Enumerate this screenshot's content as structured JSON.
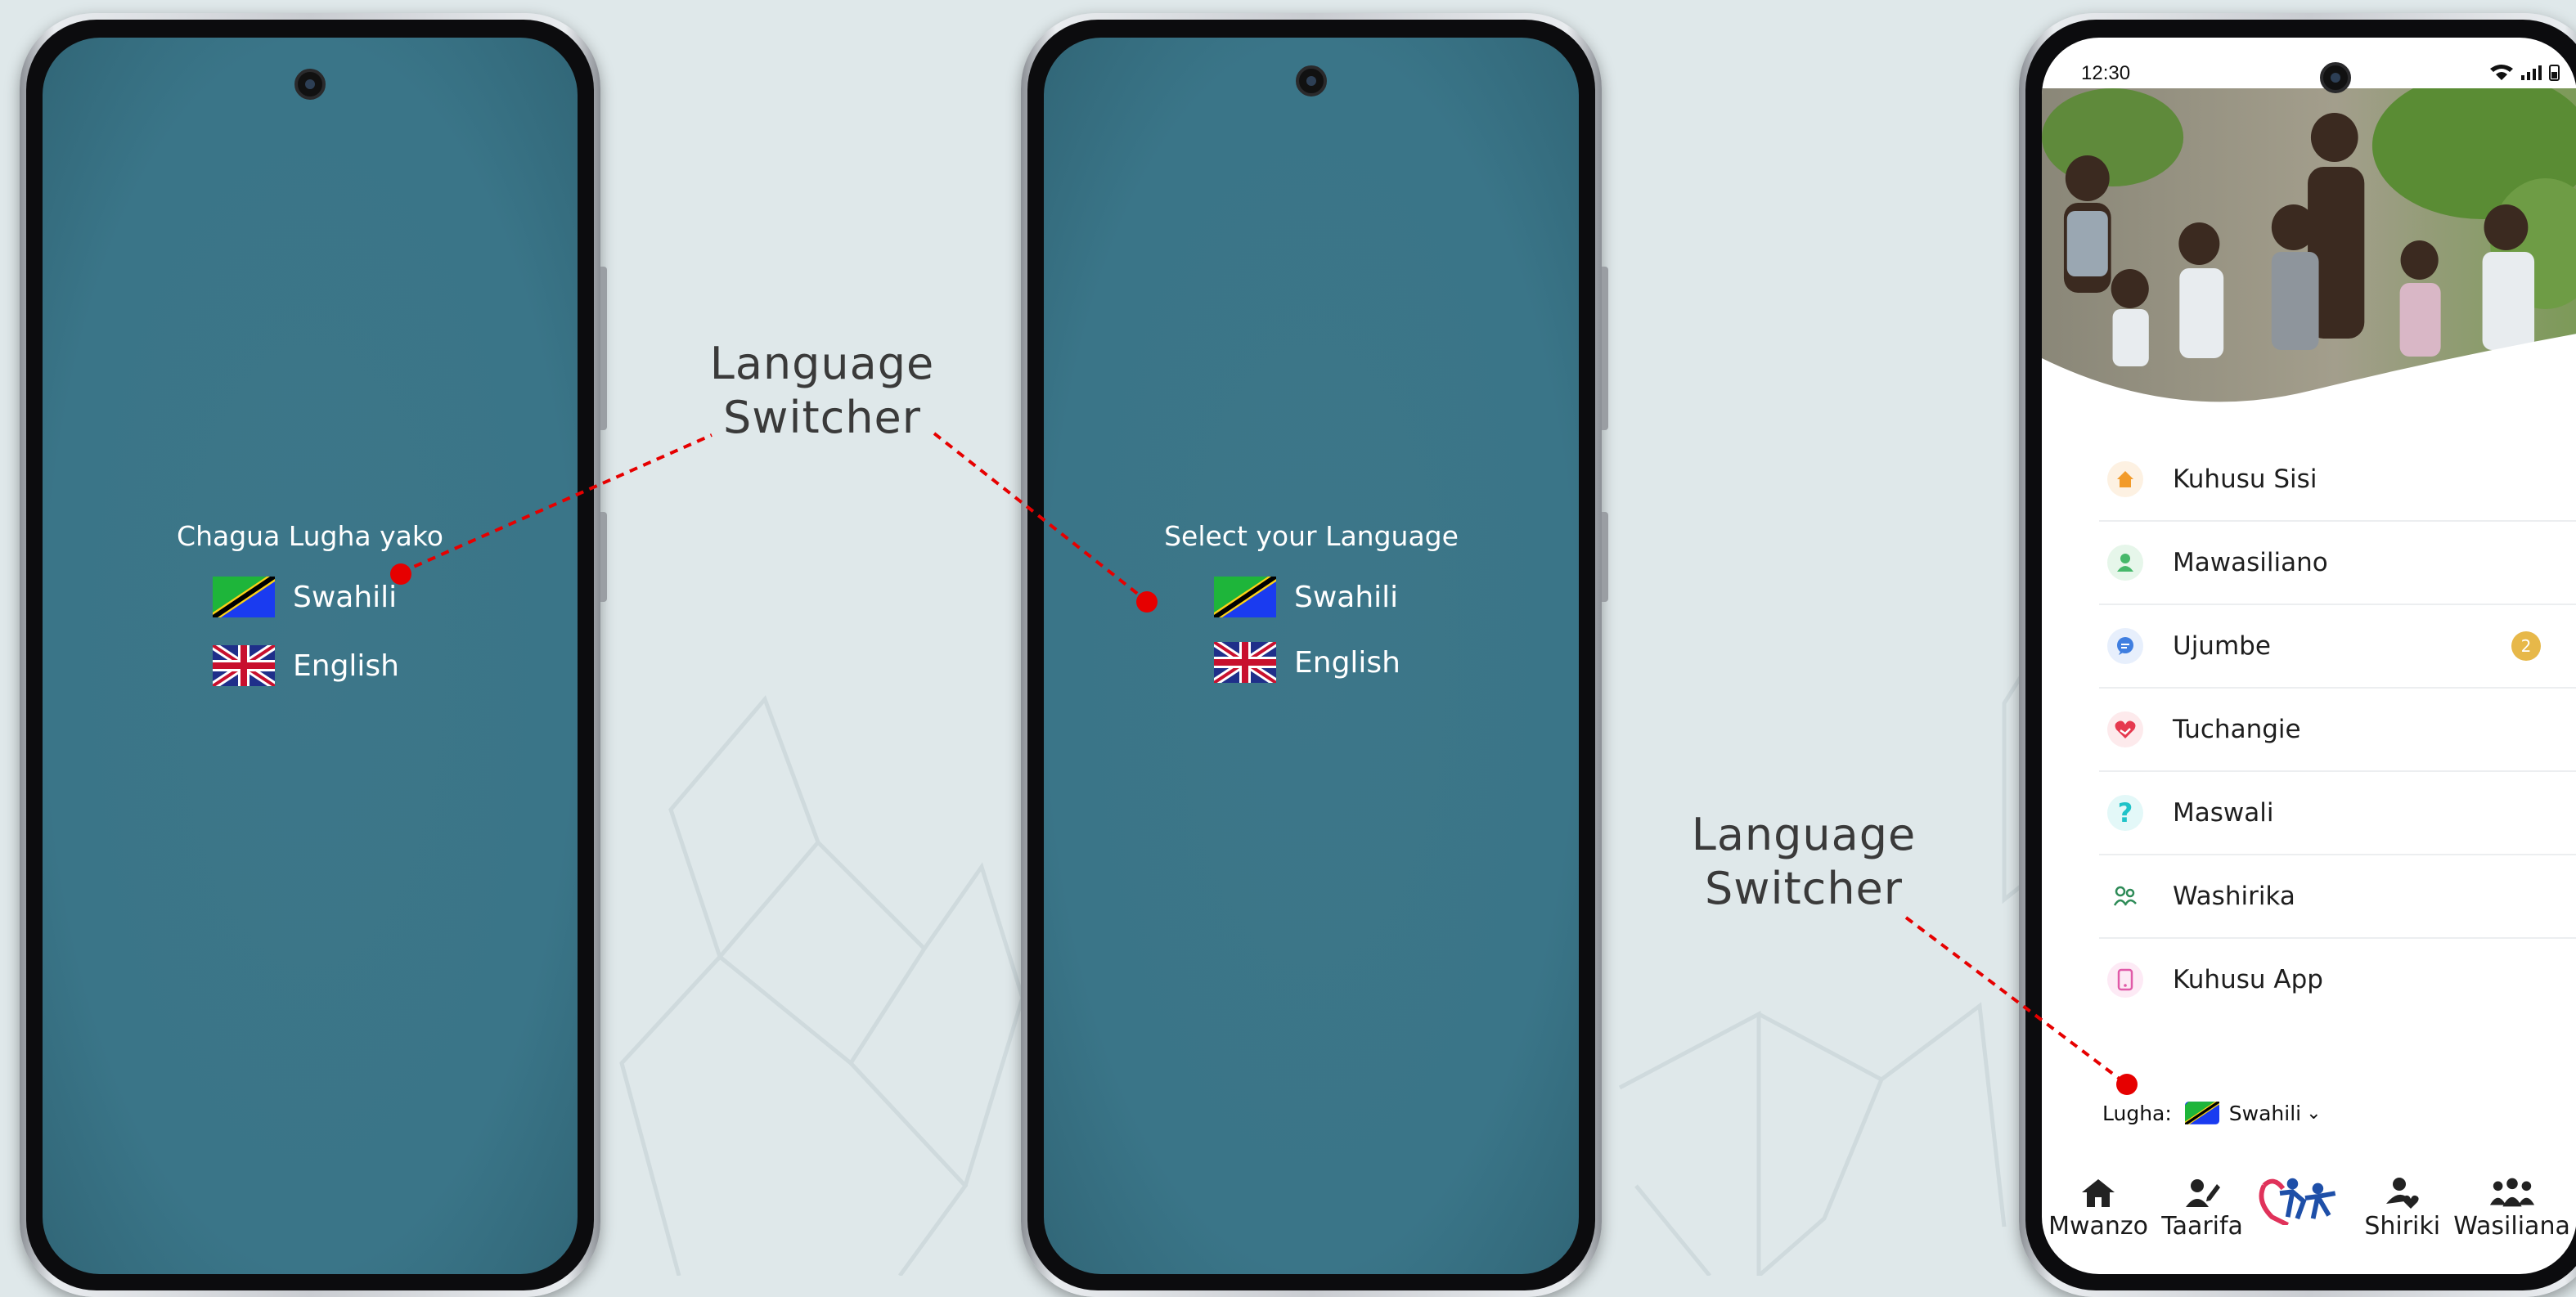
{
  "colors": {
    "background": "#dfe8ea",
    "screen_teal": "#3a7588",
    "callout_dot": "#e60000",
    "badge": "#e7b849"
  },
  "phone_left": {
    "title": "Chagua Lugha yako",
    "options": [
      {
        "label": "Swahili",
        "icon": "tanzania-flag-icon"
      },
      {
        "label": "English",
        "icon": "uk-flag-icon"
      }
    ]
  },
  "phone_middle": {
    "title": "Select your Language",
    "options": [
      {
        "label": "Swahili",
        "icon": "tanzania-flag-icon"
      },
      {
        "label": "English",
        "icon": "uk-flag-icon"
      }
    ]
  },
  "callouts": {
    "top_line1": "Language",
    "top_line2": "Switcher",
    "bottom_line1": "Language",
    "bottom_line2": "Switcher"
  },
  "phone_right": {
    "status": {
      "time": "12:30",
      "icons": [
        "wifi-icon",
        "signal-icon",
        "battery-icon"
      ]
    },
    "menu": [
      {
        "label": "Kuhusu Sisi",
        "icon": "home-icon",
        "color": "#f29b2a"
      },
      {
        "label": "Mawasiliano",
        "icon": "person-icon",
        "color": "#46b86a"
      },
      {
        "label": "Ujumbe",
        "icon": "chat-icon",
        "color": "#3f7ee0",
        "badge": "2"
      },
      {
        "label": "Tuchangie",
        "icon": "heart-hand-icon",
        "color": "#e6394f"
      },
      {
        "label": "Maswali",
        "icon": "question-icon",
        "color": "#20c3c8"
      },
      {
        "label": "Washirika",
        "icon": "people-icon",
        "color": "#2e8b57"
      },
      {
        "label": "Kuhusu App",
        "icon": "phone-icon",
        "color": "#e05aa8"
      }
    ],
    "language": {
      "label": "Lugha:",
      "value": "Swahili",
      "icon": "tanzania-flag-icon"
    },
    "bottom_nav": [
      {
        "label": "Mwanzo",
        "icon": "home-icon"
      },
      {
        "label": "Taarifa",
        "icon": "person-edit-icon"
      },
      {
        "label": "",
        "icon": "logo-icon"
      },
      {
        "label": "Shiriki",
        "icon": "person-heart-icon"
      },
      {
        "label": "Wasiliana",
        "icon": "group-icon"
      }
    ]
  }
}
